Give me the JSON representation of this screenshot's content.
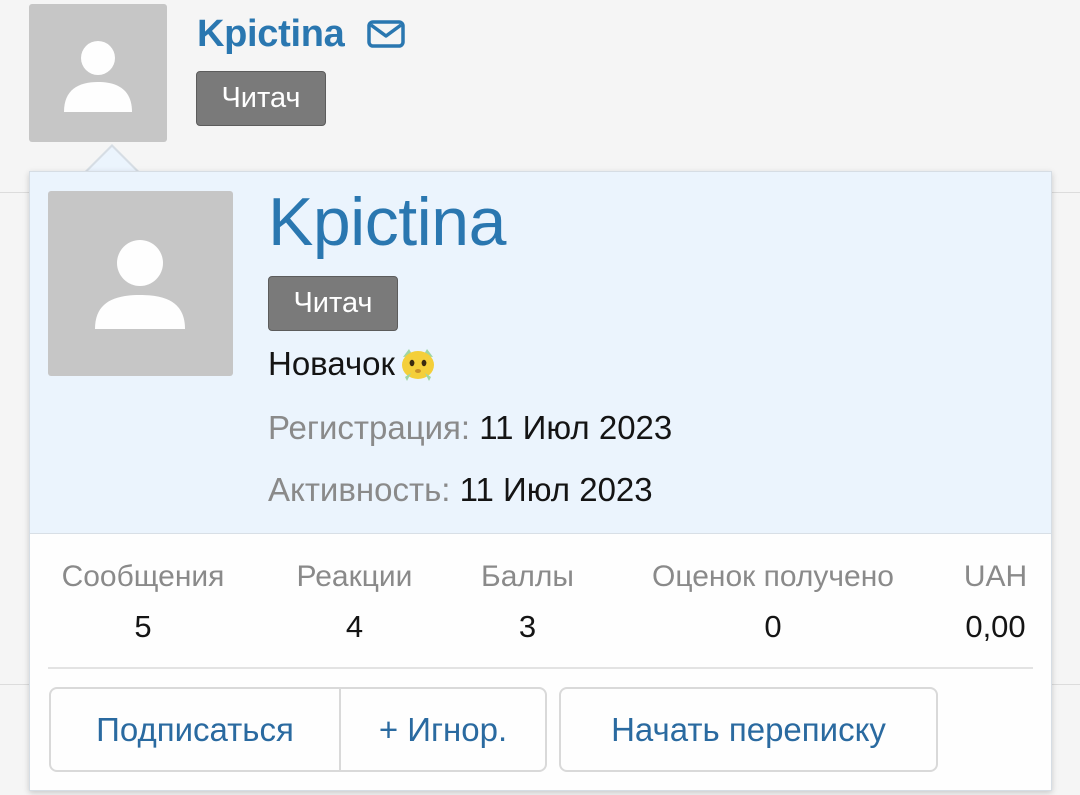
{
  "post_header": {
    "username": "Kpictina",
    "mail_icon": "envelope-icon",
    "user_title_badge": "Читач"
  },
  "member_card": {
    "username": "Kpictina",
    "user_title_badge": "Читач",
    "rank_title": "Новачок",
    "rank_icon": "newbie-smiley-icon",
    "registration": {
      "label": "Регистрация:",
      "value": "11 Июл 2023"
    },
    "activity": {
      "label": "Активность:",
      "value": "11 Июл 2023"
    },
    "stats": [
      {
        "label": "Сообщения",
        "value": "5"
      },
      {
        "label": "Реакции",
        "value": "4"
      },
      {
        "label": "Баллы",
        "value": "3"
      },
      {
        "label": "Оценок получено",
        "value": "0"
      },
      {
        "label": "UAH",
        "value": "0,00"
      }
    ],
    "buttons": {
      "follow": "Подписаться",
      "ignore": "+ Игнор.",
      "start_conversation": "Начать переписку"
    }
  },
  "colors": {
    "link_blue": "#2a77b0",
    "badge_gray": "#7a7a7a",
    "card_header_bg": "#ebf4fd",
    "avatar_placeholder": "#c6c6c6"
  }
}
